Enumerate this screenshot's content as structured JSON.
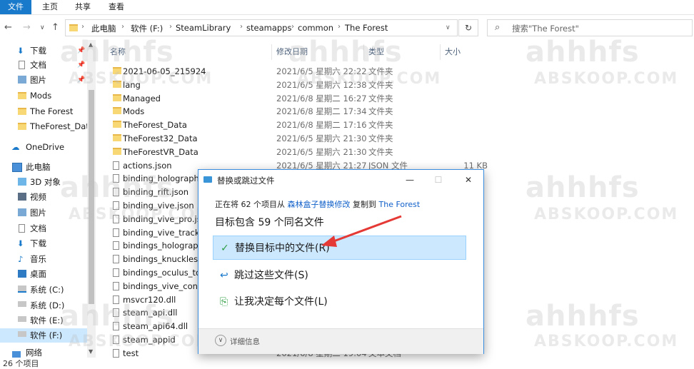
{
  "ribbon": {
    "tabs": [
      "文件",
      "主页",
      "共享",
      "查看"
    ]
  },
  "nav": {
    "back": "←",
    "forward": "→",
    "recent": "∨",
    "up": "↑",
    "refresh": "↻"
  },
  "breadcrumb": [
    "此电脑",
    "软件 (F:)",
    "SteamLibrary",
    "steamapps",
    "common",
    "The Forest"
  ],
  "search": {
    "placeholder": "搜索\"The Forest\""
  },
  "sidebar": {
    "quick_access": [
      {
        "label": "下载",
        "pinned": true
      },
      {
        "label": "文档",
        "pinned": true
      },
      {
        "label": "图片",
        "pinned": true
      },
      {
        "label": "Mods",
        "pinned": false
      },
      {
        "label": "The Forest",
        "pinned": false
      },
      {
        "label": "TheForest_Data",
        "pinned": false
      }
    ],
    "onedrive": "OneDrive",
    "this_pc": "此电脑",
    "pc_items": [
      "3D 对象",
      "视频",
      "图片",
      "文档",
      "下载",
      "音乐",
      "桌面",
      "系统 (C:)",
      "系统 (D:)",
      "软件 (E:)",
      "软件 (F:)"
    ],
    "network": "网络"
  },
  "columns": {
    "name": "名称",
    "date": "修改日期",
    "type": "类型",
    "size": "大小"
  },
  "files": [
    {
      "name": "2021-06-05_215924",
      "date": "2021/6/5 星期六 22:22",
      "type": "文件夹",
      "size": "",
      "kind": "folder"
    },
    {
      "name": "lang",
      "date": "2021/6/5 星期六 12:38",
      "type": "文件夹",
      "size": "",
      "kind": "folder"
    },
    {
      "name": "Managed",
      "date": "2021/6/8 星期二 16:27",
      "type": "文件夹",
      "size": "",
      "kind": "folder"
    },
    {
      "name": "Mods",
      "date": "2021/6/8 星期二 17:34",
      "type": "文件夹",
      "size": "",
      "kind": "folder"
    },
    {
      "name": "TheForest_Data",
      "date": "2021/6/8 星期二 17:16",
      "type": "文件夹",
      "size": "",
      "kind": "folder"
    },
    {
      "name": "TheForest32_Data",
      "date": "2021/6/5 星期六 21:30",
      "type": "文件夹",
      "size": "",
      "kind": "folder"
    },
    {
      "name": "TheForestVR_Data",
      "date": "2021/6/5 星期六 21:30",
      "type": "文件夹",
      "size": "",
      "kind": "folder"
    },
    {
      "name": "actions.json",
      "date": "2021/6/5 星期六 21:27",
      "type": "JSON 文件",
      "size": "11 KB",
      "kind": "file"
    },
    {
      "name": "binding_holographic",
      "date": "",
      "type": "",
      "size": "",
      "kind": "file"
    },
    {
      "name": "binding_rift.json",
      "date": "",
      "type": "",
      "size": "",
      "kind": "file"
    },
    {
      "name": "binding_vive.json",
      "date": "",
      "type": "",
      "size": "",
      "kind": "file"
    },
    {
      "name": "binding_vive_pro.js",
      "date": "",
      "type": "",
      "size": "",
      "kind": "file"
    },
    {
      "name": "binding_vive_tracke",
      "date": "",
      "type": "",
      "size": "",
      "kind": "file"
    },
    {
      "name": "bindings_holograph",
      "date": "",
      "type": "",
      "size": "",
      "kind": "file"
    },
    {
      "name": "bindings_knuckles.js",
      "date": "",
      "type": "",
      "size": "",
      "kind": "file"
    },
    {
      "name": "bindings_oculus_tou",
      "date": "",
      "type": "",
      "size": "",
      "kind": "file"
    },
    {
      "name": "bindings_vive_contro",
      "date": "",
      "type": "",
      "size": "",
      "kind": "file"
    },
    {
      "name": "msvcr120.dll",
      "date": "",
      "type": "",
      "size": "",
      "kind": "dll"
    },
    {
      "name": "steam_api.dll",
      "date": "",
      "type": "",
      "size": "",
      "kind": "dll"
    },
    {
      "name": "steam_api64.dll",
      "date": "",
      "type": "",
      "size": "",
      "kind": "dll"
    },
    {
      "name": "steam_appid",
      "date": "",
      "type": "",
      "size": "",
      "kind": "file"
    },
    {
      "name": "test",
      "date": "2021/6/8 星期二 19:04",
      "type": "文本文档",
      "size": "",
      "kind": "file"
    }
  ],
  "status": {
    "count": "26 个项目"
  },
  "dialog": {
    "title": "替换或跳过文件",
    "minimize": "—",
    "maximize": "☐",
    "close": "✕",
    "line1_prefix": "正在将 62 个项目从",
    "source": "森林盒子替换修改",
    "copy_to": "复制到",
    "dest": "The Forest",
    "headline": "目标包含 59 个同名文件",
    "options": [
      {
        "icon": "✓",
        "label": "替换目标中的文件(R)"
      },
      {
        "icon": "↩",
        "label": "跳过这些文件(S)"
      },
      {
        "icon": "⎘",
        "label": "让我决定每个文件(L)"
      }
    ],
    "details": "详细信息"
  },
  "watermark": {
    "text": "ahhhfs",
    "sub": "ABSKOOP.COM"
  },
  "colors": {
    "accent": "#1979ca",
    "highlight": "#cce8ff",
    "arrow": "#e53935",
    "link": "#1060c9"
  }
}
